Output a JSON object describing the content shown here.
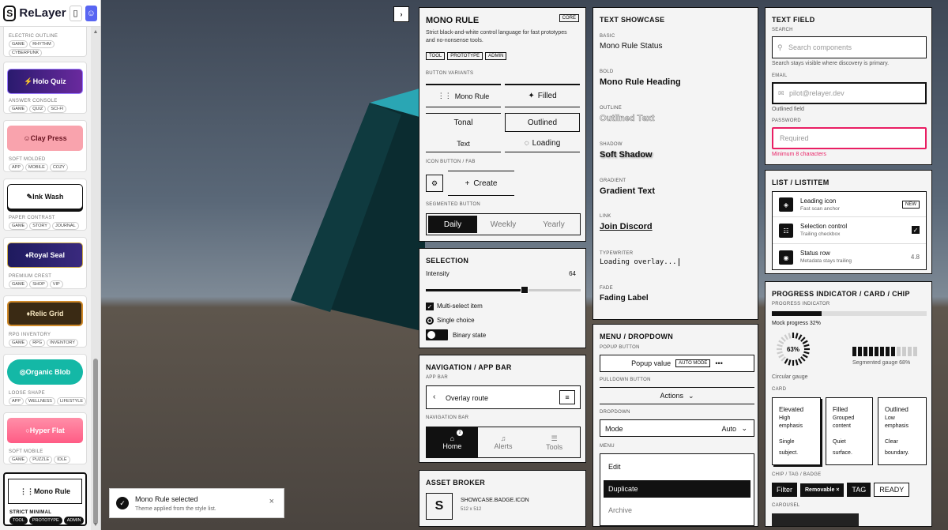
{
  "app": {
    "name": "ReLayer"
  },
  "sidebar": {
    "cards": [
      {
        "name": "",
        "meta": "ELECTRIC OUTLINE",
        "tags": [
          "GAME",
          "RHYTHM",
          "CYBERPUNK"
        ]
      },
      {
        "name": "Holo Quiz",
        "meta": "ANSWER CONSOLE",
        "tags": [
          "GAME",
          "QUIZ",
          "SCI-FI"
        ]
      },
      {
        "name": "Clay Press",
        "meta": "SOFT MOLDED",
        "tags": [
          "APP",
          "MOBILE",
          "COZY"
        ]
      },
      {
        "name": "Ink Wash",
        "meta": "PAPER CONTRAST",
        "tags": [
          "GAME",
          "STORY",
          "JOURNAL"
        ]
      },
      {
        "name": "Royal Seal",
        "meta": "PREMIUM CREST",
        "tags": [
          "GAME",
          "SHOP",
          "VIP"
        ]
      },
      {
        "name": "Relic Grid",
        "meta": "RPG INVENTORY",
        "tags": [
          "GAME",
          "RPG",
          "INVENTORY"
        ]
      },
      {
        "name": "Organic Blob",
        "meta": "LOOSE SHAPE",
        "tags": [
          "APP",
          "WELLNESS",
          "LIFESTYLE"
        ]
      },
      {
        "name": "Hyper Flat",
        "meta": "SOFT MOBILE",
        "tags": [
          "GAME",
          "PUZZLE",
          "IDLE"
        ]
      },
      {
        "name": "Mono Rule",
        "meta": "STRICT MINIMAL",
        "tags": [
          "TOOL",
          "PROTOTYPE",
          "ADMIN"
        ]
      }
    ]
  },
  "toast": {
    "title": "Mono Rule selected",
    "sub": "Theme applied from the style list."
  },
  "mono": {
    "title": "MONO RULE",
    "badge": "CORE",
    "desc": "Strict black-and-white control language for fast prototypes and no-nonsense tools.",
    "tags": [
      "TOOL",
      "PROTOTYPE",
      "ADMIN"
    ],
    "btn_section": "BUTTON VARIANTS",
    "btns": [
      "Mono Rule",
      "Filled",
      "Tonal",
      "Outlined",
      "Text",
      "Loading"
    ],
    "icon_section": "ICON BUTTON / FAB",
    "fab": "Create",
    "seg_section": "SEGMENTED BUTTON",
    "seg": [
      "Daily",
      "Weekly",
      "Yearly"
    ]
  },
  "selection": {
    "title": "SELECTION",
    "intensity_label": "Intensity",
    "intensity": 64,
    "check": "Multi-select item",
    "radio": "Single choice",
    "toggle": "Binary state"
  },
  "nav": {
    "title": "NAVIGATION / APP BAR",
    "appbar_label": "APP BAR",
    "route": "Overlay route",
    "navbar_label": "NAVIGATION BAR",
    "items": [
      "Home",
      "Alerts",
      "Tools"
    ],
    "badge": "2"
  },
  "asset": {
    "title": "ASSET BROKER",
    "name": "SHOWCASE.BADGE.ICON",
    "size": "512 x 512"
  },
  "text": {
    "title": "TEXT SHOWCASE",
    "items": [
      {
        "label": "BASIC",
        "value": "Mono Rule Status"
      },
      {
        "label": "BOLD",
        "value": "Mono Rule Heading"
      },
      {
        "label": "OUTLINE",
        "value": "Outlined Text"
      },
      {
        "label": "SHADOW",
        "value": "Soft Shadow"
      },
      {
        "label": "GRADIENT",
        "value": "Gradient Text"
      },
      {
        "label": "LINK",
        "value": "Join Discord"
      },
      {
        "label": "TYPEWRITER",
        "value": "Loading overlay..."
      },
      {
        "label": "FADE",
        "value": "Fading Label"
      }
    ]
  },
  "menu": {
    "title": "MENU / DROPDOWN",
    "popup_label": "POPUP BUTTON",
    "popup_value": "Popup value",
    "popup_chip": "AUTO MODE",
    "pulldown_label": "PULLDOWN BUTTON",
    "actions": "Actions",
    "dropdown_label": "DROPDOWN",
    "mode": "Mode",
    "mode_value": "Auto",
    "menu_label": "MENU",
    "items": [
      "Edit",
      "Duplicate",
      "Archive"
    ]
  },
  "field": {
    "title": "TEXT FIELD",
    "search_label": "SEARCH",
    "search_ph": "Search components",
    "search_help": "Search stays visible where discovery is primary.",
    "email_label": "EMAIL",
    "email_ph": "pilot@relayer.dev",
    "email_help": "Outlined field",
    "pw_label": "PASSWORD",
    "pw_ph": "Required",
    "pw_err": "Minimum 8 characters"
  },
  "list": {
    "title": "LIST / LISTITEM",
    "items": [
      {
        "title": "Leading icon",
        "sub": "Fast scan anchor",
        "trail": "NEW"
      },
      {
        "title": "Selection control",
        "sub": "Trailing checkbox",
        "trail": ""
      },
      {
        "title": "Status row",
        "sub": "Metadata stays trailing",
        "trail": "4.8"
      }
    ]
  },
  "progress": {
    "title": "PROGRESS INDICATOR / CARD / CHIP",
    "pi_label": "PROGRESS INDICATOR",
    "mock": "Mock progress 32%",
    "mock_value": 32,
    "circ_value": 63,
    "circ_text": "63%",
    "circ_label": "Circular gauge",
    "seg_value": 68,
    "seg_label": "Segmented gauge 68%",
    "card_label": "CARD",
    "cards": [
      {
        "title": "Elevated",
        "l1": "High",
        "l2": "emphasis",
        "l3": "Single",
        "l4": "subject."
      },
      {
        "title": "Filled",
        "l1": "Grouped",
        "l2": "content",
        "l3": "Quiet",
        "l4": "surface."
      },
      {
        "title": "Outlined",
        "l1": "Low",
        "l2": "emphasis",
        "l3": "Clear",
        "l4": "boundary."
      }
    ],
    "chip_label": "CHIP / TAG / BADGE",
    "chips": [
      "Filter",
      "Removable",
      "TAG",
      "READY"
    ],
    "carousel_label": "CAROUSEL"
  },
  "colors": {
    "pink": "#e91e63",
    "ink": "#111111"
  }
}
